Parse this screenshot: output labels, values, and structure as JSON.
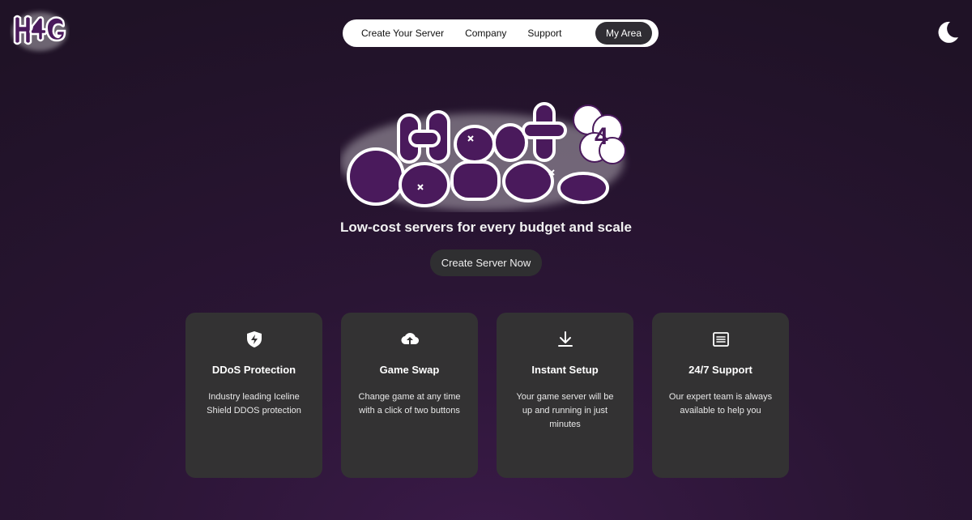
{
  "brand": {
    "small_logo_text": "H4G",
    "hero_logo_text": "HOST 4 GAMES",
    "brand_color": "#4a1a5c"
  },
  "nav": {
    "items": [
      {
        "label": "Create Your Server"
      },
      {
        "label": "Company"
      },
      {
        "label": "Support"
      },
      {
        "label": "My Area",
        "active": true
      }
    ]
  },
  "theme_toggle": {
    "icon": "moon-icon"
  },
  "hero": {
    "tagline": "Low-cost servers for every budget and scale",
    "cta_label": "Create Server Now"
  },
  "features": [
    {
      "icon": "shield-bolt-icon",
      "title": "DDoS Protection",
      "text": "Industry leading Iceline Shield DDOS protection"
    },
    {
      "icon": "cloud-upload-icon",
      "title": "Game Swap",
      "text": "Change game at any time with a click of two buttons"
    },
    {
      "icon": "download-icon",
      "title": "Instant Setup",
      "text": "Your game server will be up and running in just minutes"
    },
    {
      "icon": "newspaper-icon",
      "title": "24/7 Support",
      "text": "Our expert team is always available to help you"
    }
  ]
}
